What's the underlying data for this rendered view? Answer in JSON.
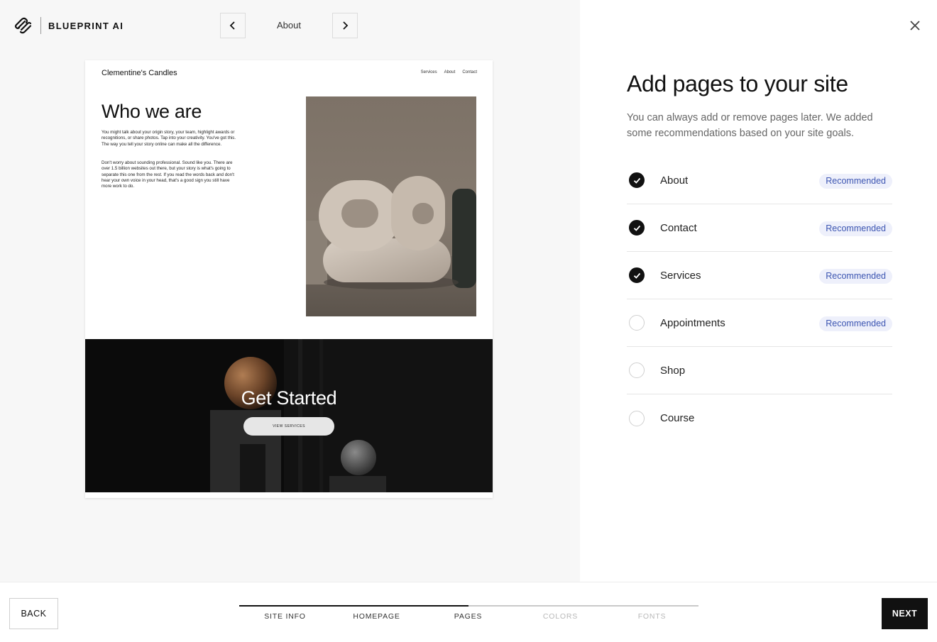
{
  "brand": {
    "name": "BLUEPRINT AI",
    "logo_icon": "squarespace-logo-icon"
  },
  "page_nav": {
    "current": "About",
    "prev_icon": "chevron-left-icon",
    "next_icon": "chevron-right-icon"
  },
  "preview": {
    "site_name": "Clementine's Candles",
    "nav": [
      "Services",
      "About",
      "Contact"
    ],
    "heading": "Who we are",
    "paragraph1": "You might talk about your origin story, your team, highlight awards or recognitions, or share photos. Tap into your creativity. You've got this. The way you tell your story online can make all the difference.",
    "paragraph2": "Don't worry about sounding professional. Sound like you. There are over 1.5 billion websites out there, but your story is what's going to separate this one from the rest. If you read the words back and don't hear your own voice in your head, that's a good sign you still have more work to do.",
    "cta_title": "Get Started",
    "cta_button": "VIEW SERVICES"
  },
  "panel": {
    "title": "Add pages to your site",
    "description": "You can always add or remove pages later. We added some recommendations based on your site goals.",
    "close_icon": "close-icon",
    "pages": [
      {
        "label": "About",
        "checked": true,
        "badge": "Recommended"
      },
      {
        "label": "Contact",
        "checked": true,
        "badge": "Recommended"
      },
      {
        "label": "Services",
        "checked": true,
        "badge": "Recommended"
      },
      {
        "label": "Appointments",
        "checked": false,
        "badge": "Recommended"
      },
      {
        "label": "Shop",
        "checked": false,
        "badge": ""
      },
      {
        "label": "Course",
        "checked": false,
        "badge": ""
      }
    ]
  },
  "footer": {
    "back": "BACK",
    "next": "NEXT",
    "steps": [
      {
        "label": "SITE INFO",
        "done": true
      },
      {
        "label": "HOMEPAGE",
        "done": true
      },
      {
        "label": "PAGES",
        "done": true
      },
      {
        "label": "COLORS",
        "done": false
      },
      {
        "label": "FONTS",
        "done": false
      }
    ]
  },
  "colors": {
    "accent": "#111111",
    "badge_bg": "#eef0fb",
    "badge_text": "#3d56b2",
    "preview_bg": "#f7f7f7"
  }
}
